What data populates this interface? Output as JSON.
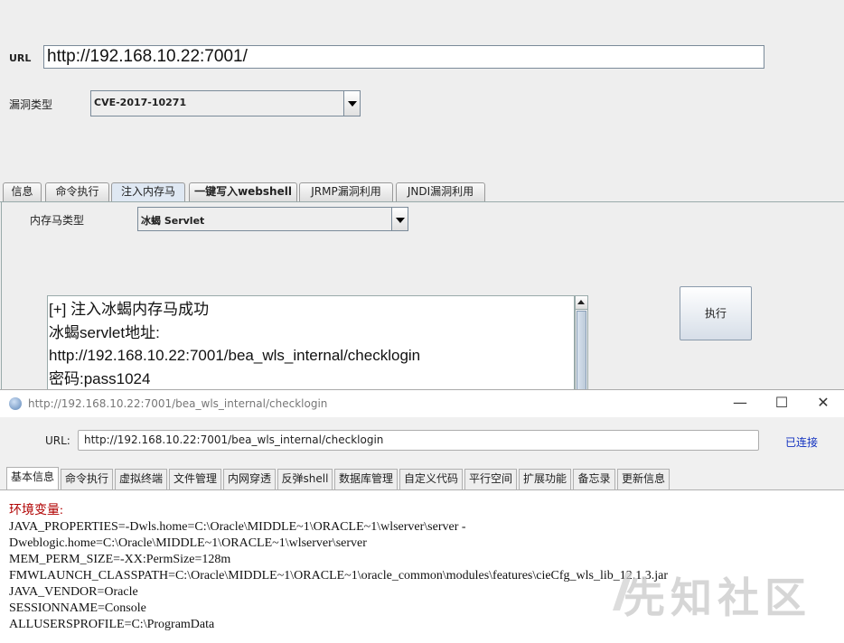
{
  "back": {
    "url_label": "URL",
    "url_value": "http://192.168.10.22:7001/",
    "vuln_label": "漏洞类型",
    "vuln_value": "CVE-2017-10271",
    "tabs": [
      "信息",
      "命令执行",
      "注入内存马",
      "一键写入webshell",
      "JRMP漏洞利用",
      "JNDI漏洞利用"
    ],
    "active_tab": "注入内存马",
    "memshell_label": "内存马类型",
    "memshell_value": "冰蝎 Servlet",
    "output_lines": [
      "[+] 注入冰蝎内存马成功",
      "冰蝎servlet地址:",
      "http://192.168.10.22:7001/bea_wls_internal/checklogin",
      "密码:pass1024"
    ],
    "execute_label": "执行"
  },
  "front": {
    "title": "http://192.168.10.22:7001/bea_wls_internal/checklogin",
    "url_label": "URL:",
    "url_value": "http://192.168.10.22:7001/bea_wls_internal/checklogin",
    "status": "已连接",
    "window_buttons": [
      "—",
      "☐",
      "✕"
    ],
    "tabs": [
      "基本信息",
      "命令执行",
      "虚拟终端",
      "文件管理",
      "内网穿透",
      "反弹shell",
      "数据库管理",
      "自定义代码",
      "平行空间",
      "扩展功能",
      "备忘录",
      "更新信息"
    ],
    "active_tab": "基本信息",
    "env_title": "环境变量:",
    "env_lines": [
      "JAVA_PROPERTIES=-Dwls.home=C:\\Oracle\\MIDDLE~1\\ORACLE~1\\wlserver\\server -",
      "Dweblogic.home=C:\\Oracle\\MIDDLE~1\\ORACLE~1\\wlserver\\server",
      "MEM_PERM_SIZE=-XX:PermSize=128m",
      "FMWLAUNCH_CLASSPATH=C:\\Oracle\\MIDDLE~1\\ORACLE~1\\oracle_common\\modules\\features\\cieCfg_wls_lib_12.1.3.jar",
      "JAVA_VENDOR=Oracle",
      "SESSIONNAME=Console",
      "ALLUSERSPROFILE=C:\\ProgramData"
    ]
  },
  "watermark": "先知社区"
}
